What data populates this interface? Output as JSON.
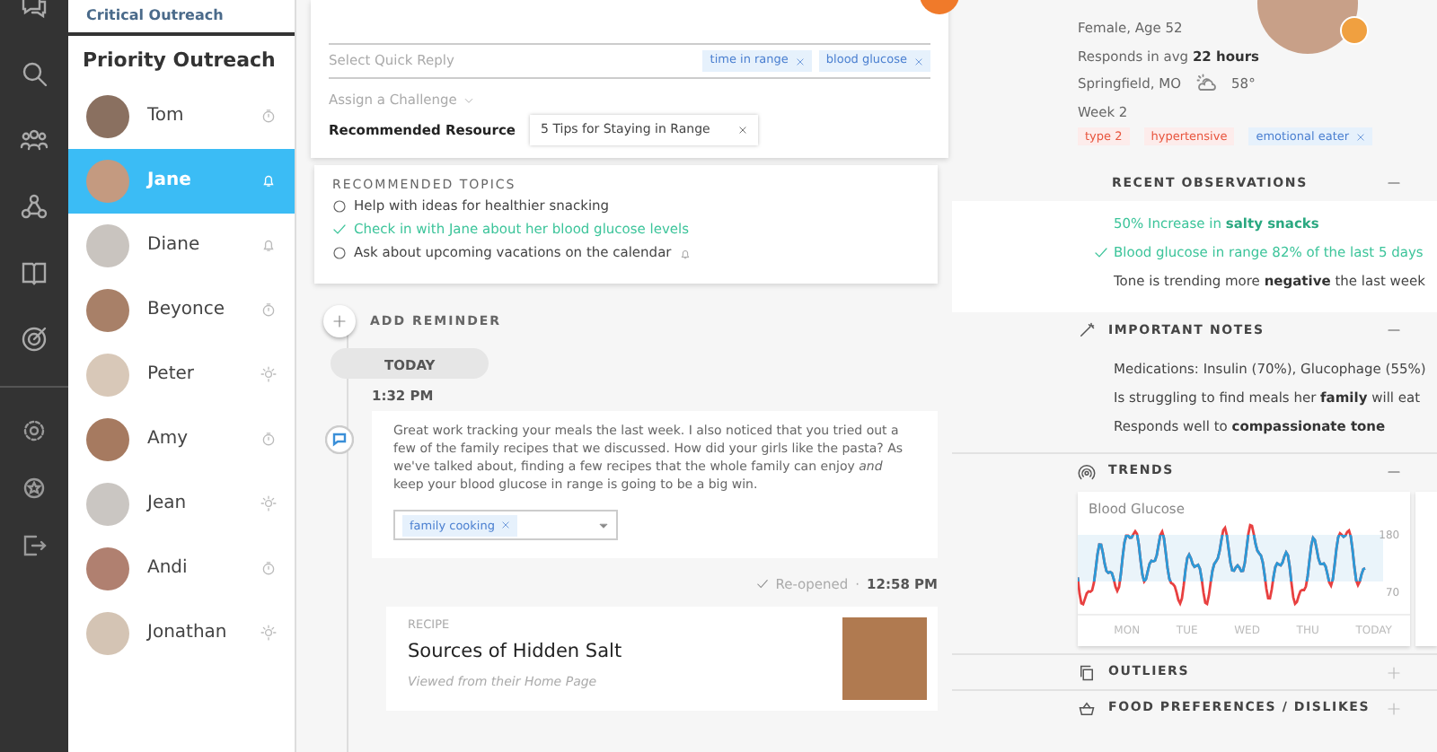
{
  "sidebar_header": "Critical Outreach",
  "patient_list": {
    "title": "Priority Outreach",
    "items": [
      {
        "name": "Tom",
        "kind": "timer",
        "selected": false
      },
      {
        "name": "Jane",
        "kind": "bell",
        "selected": true
      },
      {
        "name": "Diane",
        "kind": "bell",
        "selected": false
      },
      {
        "name": "Beyonce",
        "kind": "timer",
        "selected": false
      },
      {
        "name": "Peter",
        "kind": "bulb",
        "selected": false
      },
      {
        "name": "Amy",
        "kind": "timer",
        "selected": false
      },
      {
        "name": "Jean",
        "kind": "bulb",
        "selected": false
      },
      {
        "name": "Andi",
        "kind": "timer",
        "selected": false
      },
      {
        "name": "Jonathan",
        "kind": "bulb",
        "selected": false
      }
    ]
  },
  "composer": {
    "quick_reply": {
      "placeholder": "Select Quick Reply",
      "tags": [
        "time in range",
        "blood glucose"
      ]
    },
    "challenge": {
      "placeholder": "Assign a Challenge"
    },
    "resource": {
      "label": "Recommended Resource",
      "value": "5 Tips for Staying in Range"
    }
  },
  "recommended_topics": {
    "title": "RECOMMENDED TOPICS",
    "items": [
      {
        "text": "Help with ideas for healthier snacking",
        "checked": false,
        "reminder": false
      },
      {
        "text": "Check in with Jane about her blood glucose levels",
        "checked": true,
        "reminder": false
      },
      {
        "text": "Ask about upcoming vacations on the calendar",
        "checked": false,
        "reminder": true
      }
    ]
  },
  "add_reminder": "ADD REMINDER",
  "timeline": {
    "day": "TODAY",
    "time": "1:32 PM",
    "message": {
      "text": "Great work tracking your meals the last week. I also noticed that you tried out a few of the family recipes that we discussed. How did your girls like the pasta? As we've talked about, finding a few recipes that the whole family can enjoy *and* keep your blood glucose in range is going to be a big win.",
      "tags": [
        "family cooking"
      ]
    },
    "status": "Re-opened",
    "status_separator": "·",
    "status_time": "12:58 PM",
    "resource_card": {
      "category": "RECIPE",
      "title": "Sources of Hidden Salt",
      "source": "Viewed from their Home Page"
    }
  },
  "profile": {
    "details": [
      "Female, Age 52",
      "Responds in avg **22 hours**"
    ],
    "location": "Springfield, MO",
    "temperature": "58°",
    "week": "Week 2",
    "tags": [
      {
        "label": "type 2",
        "color": "#e8553e",
        "removable": false
      },
      {
        "label": "hypertensive",
        "color": "#e8553e",
        "removable": false
      },
      {
        "label": "emotional eater",
        "color": "#4a7fd0",
        "removable": true
      }
    ]
  },
  "sections": [
    {
      "kind": "observations",
      "title": "RECENT OBSERVATIONS",
      "expanded": true,
      "items": [
        {
          "text": "50% Increase in **salty snacks**",
          "highlight": true,
          "checked": false
        },
        {
          "text": "Blood glucose in range 82% of the last 5 days",
          "highlight": true,
          "checked": true
        },
        {
          "text": "Tone is trending more **negative** the last week",
          "highlight": false,
          "checked": false
        }
      ]
    },
    {
      "kind": "notes",
      "title": "IMPORTANT NOTES",
      "expanded": true,
      "items": [
        {
          "text": "Medications: Insulin (70%), Glucophage (55%)",
          "highlight": false,
          "checked": false
        },
        {
          "text": "Is struggling to find meals her **family** will eat",
          "highlight": false,
          "checked": false
        },
        {
          "text": "Responds well to **compassionate tone**",
          "highlight": false,
          "checked": false
        }
      ]
    },
    {
      "kind": "trends",
      "title": "TRENDS",
      "expanded": true,
      "chart": {
        "title": "Blood Glucose",
        "y_labels": [
          "180",
          "70"
        ],
        "x_labels": [
          "MON",
          "TUE",
          "WED",
          "THU",
          "TODAY"
        ]
      }
    },
    {
      "kind": "outliers",
      "title": "OUTLIERS",
      "expanded": false
    },
    {
      "kind": "food",
      "title": "FOOD PREFERENCES / DISLIKES",
      "expanded": false
    }
  ]
}
